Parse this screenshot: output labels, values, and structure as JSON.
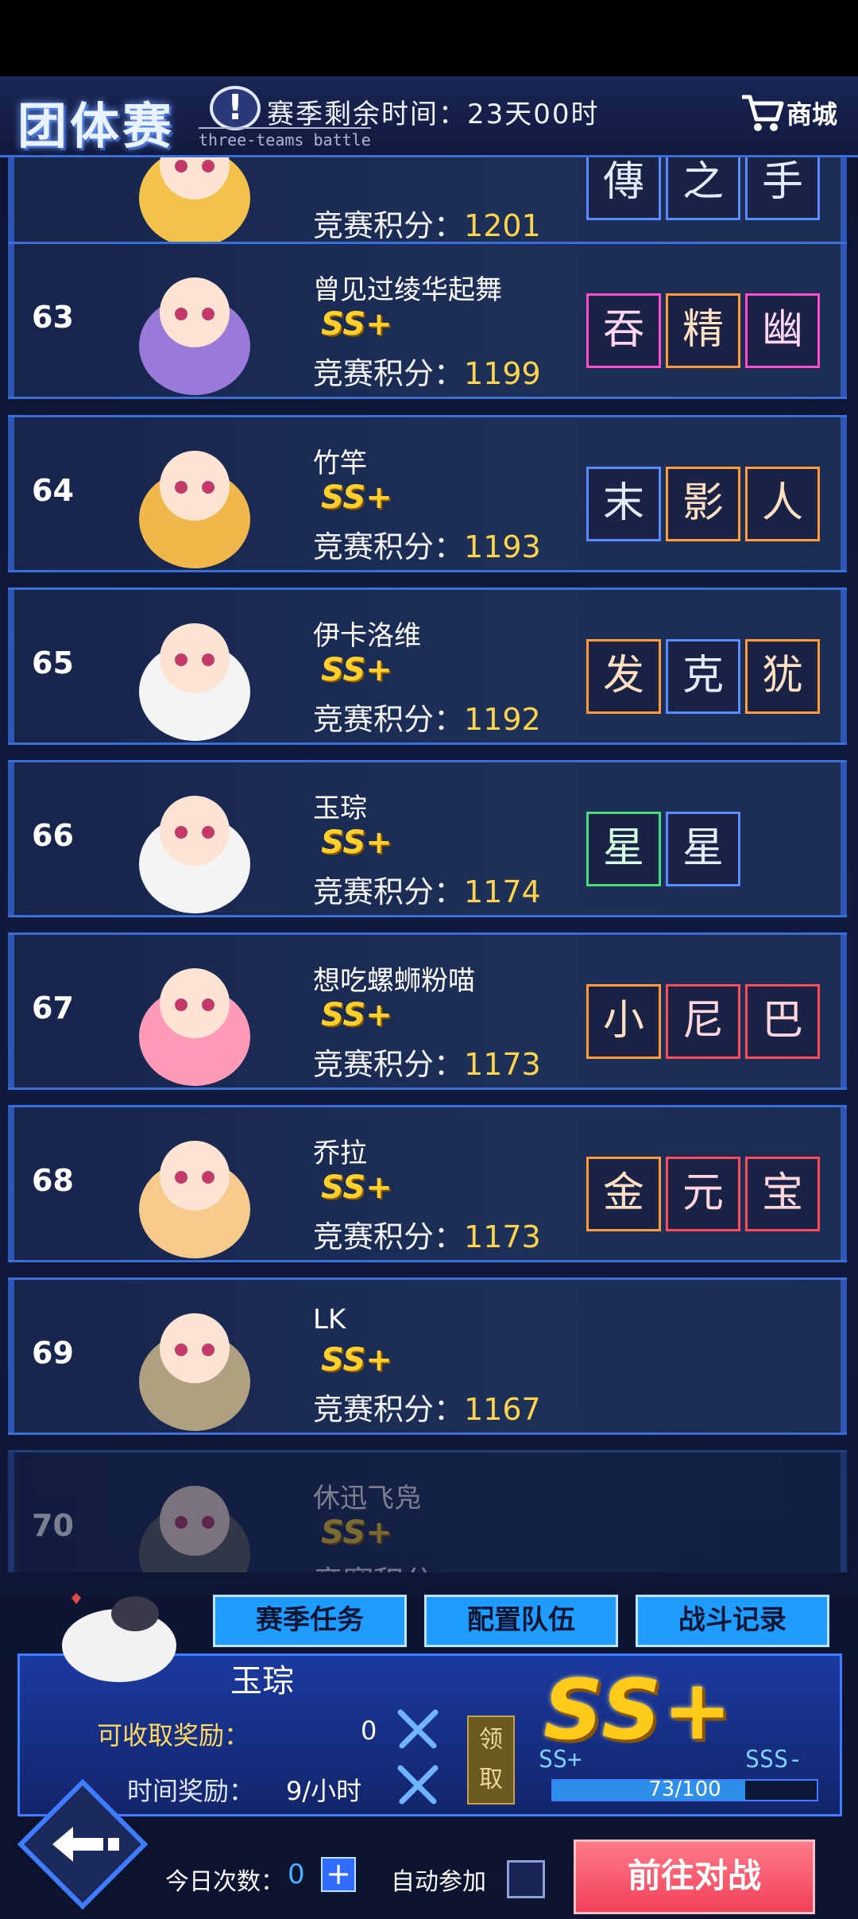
{
  "header": {
    "title": "团体赛",
    "subtitle": "three-teams battle",
    "alert_symbol": "!",
    "season_time": "赛季剩余时间：23天00时",
    "shop_label": "商城",
    "shop_icon": "cart-icon"
  },
  "score_label": "竞赛积分：",
  "rows": [
    {
      "rank": "",
      "name": "",
      "tier": "",
      "score": "1201",
      "tags": [
        "傳",
        "之",
        "手"
      ],
      "tag_styles": [
        "blue",
        "blue",
        "blue"
      ]
    },
    {
      "rank": "63",
      "name": "曾见过绫华起舞",
      "tier": "SS+",
      "score": "1199",
      "tags": [
        "吞",
        "精",
        "幽"
      ],
      "tag_styles": [
        "pink",
        "orange",
        "pink"
      ]
    },
    {
      "rank": "64",
      "name": "竹竿",
      "tier": "SS+",
      "score": "1193",
      "tags": [
        "末",
        "影",
        "人"
      ],
      "tag_styles": [
        "blue",
        "orange",
        "orange"
      ]
    },
    {
      "rank": "65",
      "name": "伊卡洛维",
      "tier": "SS+",
      "score": "1192",
      "tags": [
        "发",
        "克",
        "犹"
      ],
      "tag_styles": [
        "orange",
        "blue",
        "orange"
      ]
    },
    {
      "rank": "66",
      "name": "玉琮",
      "tier": "SS+",
      "score": "1174",
      "tags": [
        "星",
        "星"
      ],
      "tag_styles": [
        "green",
        "blue"
      ]
    },
    {
      "rank": "67",
      "name": "想吃螺蛳粉喵",
      "tier": "SS+",
      "score": "1173",
      "tags": [
        "小",
        "尼",
        "巴"
      ],
      "tag_styles": [
        "orange",
        "red",
        "red"
      ]
    },
    {
      "rank": "68",
      "name": "乔拉",
      "tier": "SS+",
      "score": "1173",
      "tags": [
        "金",
        "元",
        "宝"
      ],
      "tag_styles": [
        "orange",
        "red",
        "red"
      ]
    },
    {
      "rank": "69",
      "name": "LK",
      "tier": "SS+",
      "score": "1167",
      "tags": [],
      "tag_styles": []
    },
    {
      "rank": "70",
      "name": "休迅飞凫",
      "tier": "SS+",
      "score": "",
      "tags": [],
      "tag_styles": []
    }
  ],
  "tabs": {
    "season_tasks": "赛季任务",
    "team_config": "配置队伍",
    "battle_log": "战斗记录"
  },
  "me": {
    "name": "玉琮",
    "reward_label": "可收取奖励：",
    "reward_value": "0",
    "time_reward_label": "时间奖励：",
    "time_reward_value": "9/小时",
    "claim_label": "领取",
    "tier": "SS+",
    "tier_low": "SS+",
    "tier_high": "SSS-",
    "progress_text": "73/100",
    "progress_fraction": 0.73
  },
  "footer": {
    "today_label": "今日次数：",
    "today_value": "0",
    "plus_label": "+",
    "auto_label": "自动参加",
    "battle_label": "前往对战"
  }
}
